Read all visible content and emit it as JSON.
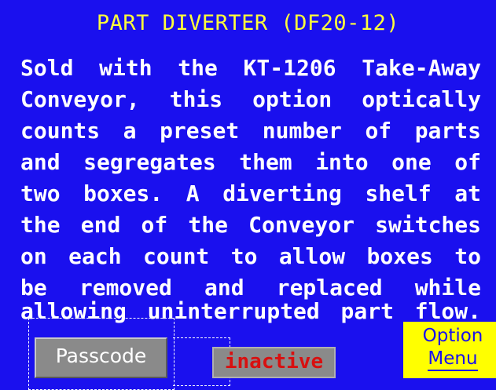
{
  "screen": {
    "title": "PART DIVERTER (DF20-12)",
    "description_lines": [
      "Sold with  the KT-1206  Take-Away",
      "Conveyor,  this option  optically",
      "counts a  preset number  of parts",
      "and  segregates them  into one of",
      "two boxes.   A diverting shelf at",
      "the end of the  Conveyor switches",
      "on each  count to allow  boxes to",
      "be  removed  and  replaced  while",
      "allowing uninterrupted part flow."
    ]
  },
  "buttons": {
    "passcode_label": "Passcode",
    "option_menu_line1": "Option",
    "option_menu_line2": "Menu"
  },
  "status": {
    "state_label": "inactive"
  },
  "colors": {
    "background": "#1a10ee",
    "title": "#ffff3a",
    "text": "#ffffff",
    "option_button": "#ffff00",
    "inactive_text": "#d81010",
    "gray_button": "#8a8a8a"
  }
}
